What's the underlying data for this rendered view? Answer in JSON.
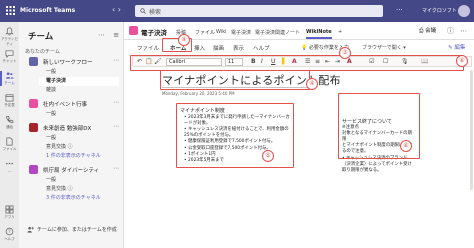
{
  "app": {
    "name": "Microsoft Teams",
    "search_placeholder": "検索",
    "org": "マイクロソフト",
    "more": "···"
  },
  "rail": {
    "items": [
      {
        "label": "アクティビティ",
        "icon": "bell-icon"
      },
      {
        "label": "チャット",
        "icon": "chat-icon"
      },
      {
        "label": "チーム",
        "icon": "teams-icon",
        "active": true
      },
      {
        "label": "予定表",
        "icon": "calendar-icon"
      },
      {
        "label": "通話",
        "icon": "phone-icon"
      },
      {
        "label": "ファイル",
        "icon": "file-icon"
      },
      {
        "label": "…",
        "icon": "more-icon"
      }
    ],
    "apps_label": "アプリ",
    "help_label": "ヘルプ"
  },
  "teams_panel": {
    "header": "チーム",
    "section_label": "あなたのチーム",
    "teams": [
      {
        "name": "新しいワークフロー",
        "color": "#6264a7",
        "channels": [
          {
            "label": "一般"
          },
          {
            "label": "電子決済",
            "active": true
          },
          {
            "label": "雑談"
          }
        ]
      },
      {
        "name": "社内イベント行事",
        "color": "#e8519f",
        "channels": [
          {
            "label": "一般"
          }
        ]
      },
      {
        "name": "未来創造 勉強部DX",
        "color": "#a4262c",
        "channels": [
          {
            "label": "一般"
          },
          {
            "label": "意見交換 ⓘ"
          },
          {
            "label": "1 件の非表示のチャネル",
            "link": true
          }
        ]
      },
      {
        "name": "県庁局 ダイバーシティ",
        "color": "#b146c2",
        "channels": [
          {
            "label": "一般"
          },
          {
            "label": "意見交換 ⓘ"
          },
          {
            "label": "3 件の非表示のチャネル",
            "link": true
          }
        ]
      }
    ],
    "join_label": "チームに参加、またはチームを作成"
  },
  "channel": {
    "name": "電子決済",
    "tabs": [
      {
        "label": "投稿"
      },
      {
        "label": "ファイル"
      },
      {
        "label": "Wiki"
      },
      {
        "label": "電子決済"
      },
      {
        "label": "電子決済関連ノート"
      },
      {
        "label": "WikiNote",
        "active": true
      }
    ],
    "add_tab": "+",
    "meet_label": "会議"
  },
  "ribbon": {
    "tabs": [
      {
        "label": "ファイル"
      },
      {
        "label": "ホーム",
        "active": true
      },
      {
        "label": "挿入"
      },
      {
        "label": "描画"
      },
      {
        "label": "表示"
      },
      {
        "label": "ヘルプ"
      }
    ],
    "tell_me": "必要な作業を入力",
    "open_in_browser": "ブラウザーで開く",
    "edit_label": "編集",
    "font_name": "Calibri",
    "font_size": "11",
    "buttons": [
      "B",
      "I",
      "U",
      "A"
    ]
  },
  "page": {
    "title": "マイナポイントによるポイント配布",
    "date": "Monday, February 20, 2023   5:40 PM",
    "note1": {
      "heading": "マイナポイント制度",
      "items": [
        "2023年3月末までに発行申請した一マイナンバーカードが対象。",
        "キャッシュレス決済を紐付けることで、利用金額の25%のポイントを付与。",
        "健康保険証利用登録で7,500ポイント付与。",
        "公金受取口座登録で7,500ポイント付与。",
        "1ポイント1円",
        "2023年5月末まで"
      ]
    },
    "note2": {
      "heading": "サービス終了について",
      "lines": [
        "※注意点",
        "対象となるマイナンバーカードの期限",
        "とマイナポイント制度の期限は異なるので注意。"
      ],
      "items": [
        "キャッシュレス決済のブランド（決済企業）によってポイント受け取り期限が異なる。"
      ]
    }
  },
  "markers": [
    "④",
    "③",
    "⑥",
    "④",
    "⑤",
    "⑥"
  ],
  "colors": {
    "title_bar": "#454886",
    "accent": "#5b5fc7",
    "annotation": "#e3514a"
  }
}
